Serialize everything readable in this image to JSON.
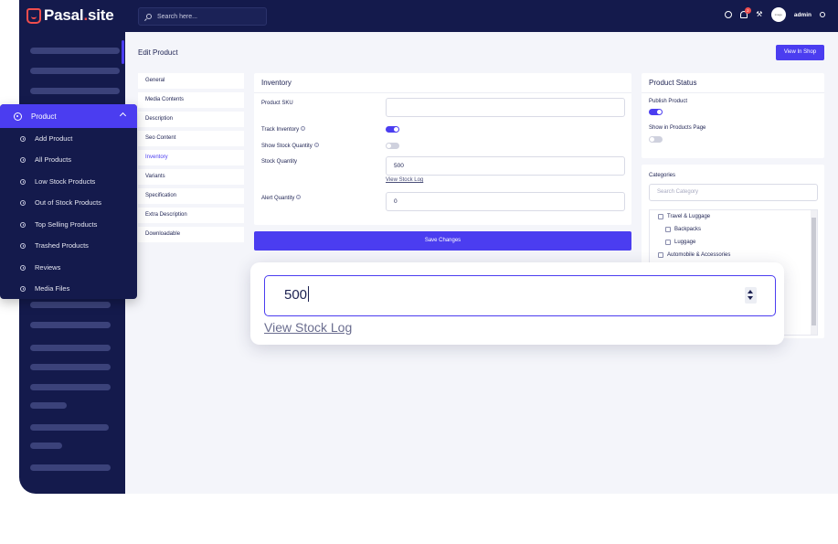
{
  "app": {
    "logo_main": "Pasal",
    "logo_dot": ".",
    "logo_tld": "site"
  },
  "topbar": {
    "search_placeholder": "Search here...",
    "notification_count": "2",
    "avatar_text": "image",
    "user": "admin"
  },
  "page": {
    "title": "Edit Product",
    "view_shop": "View In Shop"
  },
  "subnav": [
    "General",
    "Media Contents",
    "Description",
    "Seo Content",
    "Inventory",
    "Variants",
    "Specification",
    "Extra Description",
    "Downloadable"
  ],
  "subnav_active": "Inventory",
  "inventory": {
    "title": "Inventory",
    "sku_label": "Product SKU",
    "sku_value": "",
    "track_label": "Track Inventory",
    "track_on": true,
    "show_stock_label": "Show Stock Quantity",
    "show_stock_on": false,
    "stock_label": "Stock Quantity",
    "stock_value": "500",
    "view_stock_log": "View Stock Log",
    "alert_label": "Alert Quantity",
    "alert_value": "0",
    "save": "Save Changes"
  },
  "status": {
    "title": "Product Status",
    "publish_label": "Publish Product",
    "publish_on": true,
    "show_page_label": "Show in Products Page",
    "show_page_on": false
  },
  "categories": {
    "title": "Categories",
    "search_placeholder": "Search Category",
    "items": [
      "Travel & Luggage",
      "Backpacks",
      "Luggage",
      "Automobile & Accessories"
    ]
  },
  "submenu": {
    "title": "Product",
    "items": [
      "Add Product",
      "All Products",
      "Low Stock Products",
      "Out of Stock Products",
      "Top Selling Products",
      "Trashed Products",
      "Reviews",
      "Media Files"
    ]
  },
  "zoom": {
    "value": "500",
    "link": "View Stock Log"
  },
  "colors": {
    "primary": "#4b3df0",
    "sidebar": "#141a4c",
    "accent": "#ef4d4d",
    "background": "#f4f5fa"
  }
}
